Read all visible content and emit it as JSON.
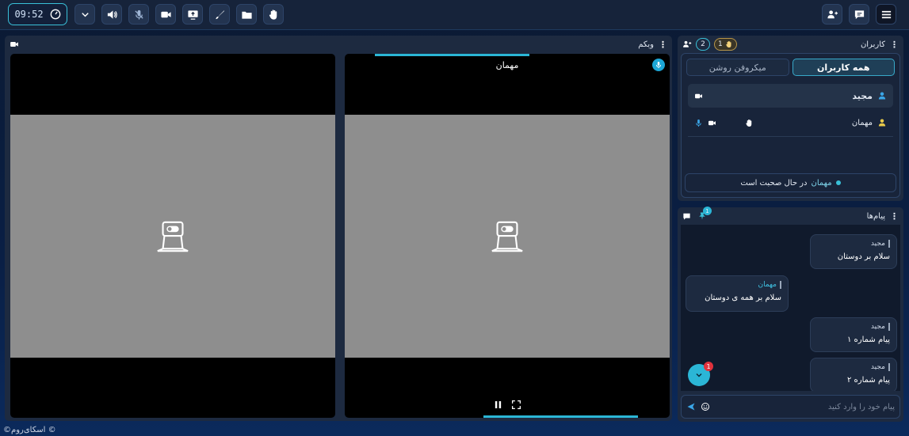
{
  "topbar": {
    "clock": "09:52"
  },
  "video": {
    "title": "وبکم",
    "tiles": [
      {
        "name": ""
      },
      {
        "name": "مهمان"
      }
    ]
  },
  "users": {
    "title": "کاربران",
    "hand_count": "1",
    "user_count": "2",
    "tabs": [
      "همه کاربران",
      "میکروفن روشن"
    ],
    "list": [
      {
        "name": "مجید"
      },
      {
        "name": "مهمان"
      }
    ],
    "status_name": "مهمان",
    "status_text": "در حال صحبت است"
  },
  "chat": {
    "title": "پیام‌ها",
    "pin_badge": "1",
    "messages": [
      {
        "sender": "مجید",
        "body": "سلام بر دوستان"
      },
      {
        "sender": "مهمان",
        "body": "سلام بر همه ی دوستان"
      },
      {
        "sender": "مجید",
        "body": "پیام شماره ۱"
      },
      {
        "sender": "مجید",
        "body": "پیام شماره ۲"
      }
    ],
    "unread": "1",
    "input_placeholder": "پیام خود را وارد کنید"
  },
  "footer": "©اسکای‌روم ©"
}
